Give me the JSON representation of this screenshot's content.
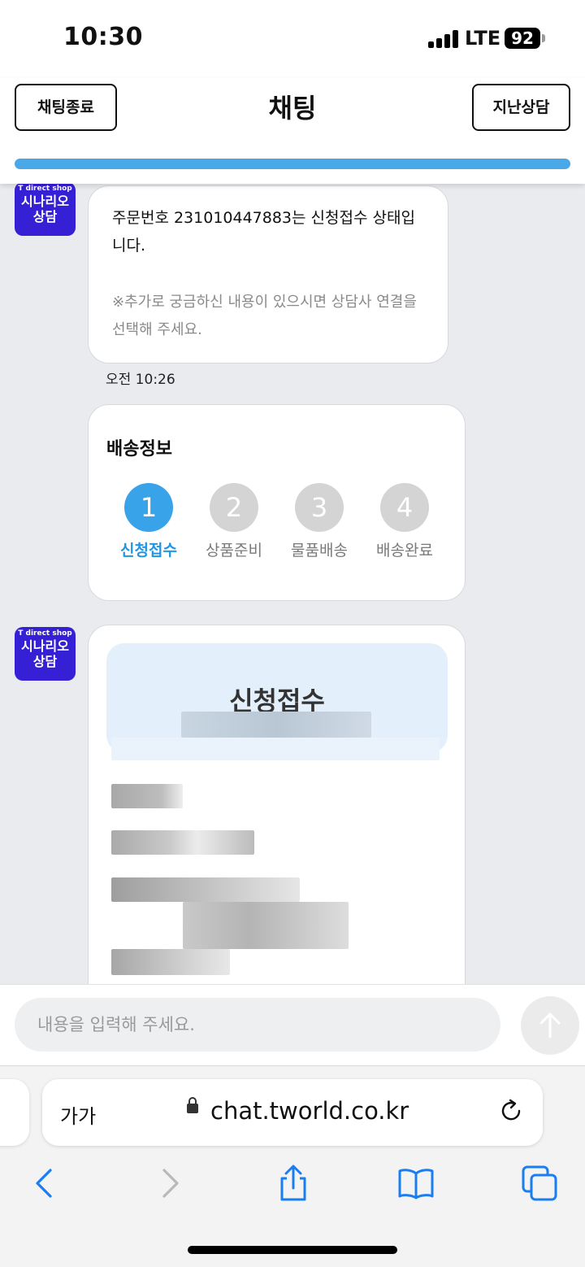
{
  "status_bar": {
    "time": "10:30",
    "network": "LTE",
    "battery": "92"
  },
  "header": {
    "end_chat_label": "채팅종료",
    "title": "채팅",
    "history_label": "지난상담"
  },
  "bot": {
    "brand": "T direct shop",
    "name_line1": "시나리오",
    "name_line2": "상담"
  },
  "message": {
    "text": "주문번호 231010447883는 신청접수 상태입니다.",
    "note": "※추가로 궁금하신 내용이 있으시면 상담사 연결을 선택해 주세요.",
    "time": "오전 10:26"
  },
  "delivery_card": {
    "title": "배송정보",
    "steps": [
      {
        "num": "1",
        "label": "신청접수"
      },
      {
        "num": "2",
        "label": "상품준비"
      },
      {
        "num": "3",
        "label": "물품배송"
      },
      {
        "num": "4",
        "label": "배송완료"
      }
    ],
    "active_step": "1"
  },
  "status_card": {
    "title": "신청접수"
  },
  "input": {
    "placeholder": "내용을 입력해 주세요."
  },
  "browser": {
    "text_size_label": "가가",
    "url": "chat.tworld.co.kr"
  },
  "colors": {
    "accent": "#38a3e8",
    "bot_avatar": "#3520d6",
    "progress": "#4aa8e8"
  },
  "icons": [
    "lock-icon",
    "reload-icon",
    "back-icon",
    "forward-icon",
    "share-icon",
    "bookmarks-icon",
    "tabs-icon",
    "send-arrow-icon"
  ]
}
